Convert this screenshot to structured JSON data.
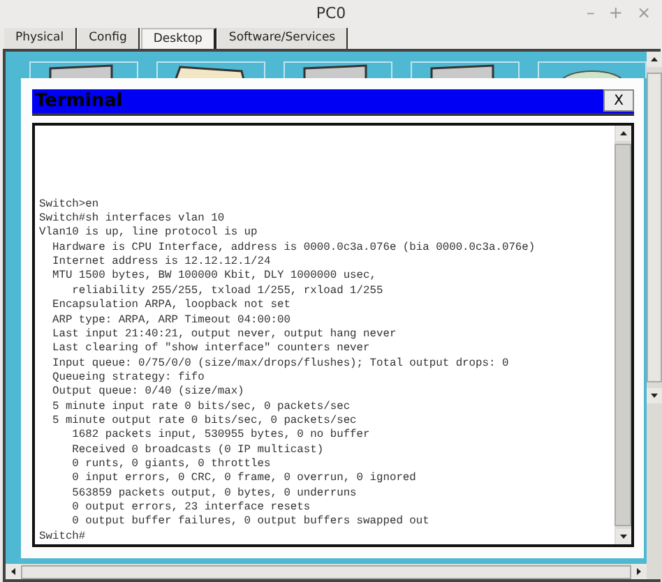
{
  "window": {
    "title": "PC0",
    "controls": [
      "–",
      "+",
      "×"
    ]
  },
  "tabs": [
    {
      "label": "Physical",
      "selected": false
    },
    {
      "label": "Config",
      "selected": false
    },
    {
      "label": "Desktop",
      "selected": true
    },
    {
      "label": "Software/Services",
      "selected": false
    }
  ],
  "terminal": {
    "title": "Terminal",
    "close": "X",
    "lines": [
      "Switch>en",
      "Switch#sh interfaces vlan 10",
      "Vlan10 is up, line protocol is up",
      "  Hardware is CPU Interface, address is 0000.0c3a.076e (bia 0000.0c3a.076e)",
      "  Internet address is 12.12.12.1/24",
      "  MTU 1500 bytes, BW 100000 Kbit, DLY 1000000 usec,",
      "     reliability 255/255, txload 1/255, rxload 1/255",
      "  Encapsulation ARPA, loopback not set",
      "  ARP type: ARPA, ARP Timeout 04:00:00",
      "  Last input 21:40:21, output never, output hang never",
      "  Last clearing of \"show interface\" counters never",
      "  Input queue: 0/75/0/0 (size/max/drops/flushes); Total output drops: 0",
      "  Queueing strategy: fifo",
      "  Output queue: 0/40 (size/max)",
      "  5 minute input rate 0 bits/sec, 0 packets/sec",
      "  5 minute output rate 0 bits/sec, 0 packets/sec",
      "     1682 packets input, 530955 bytes, 0 no buffer",
      "     Received 0 broadcasts (0 IP multicast)",
      "     0 runts, 0 giants, 0 throttles",
      "     0 input errors, 0 CRC, 0 frame, 0 overrun, 0 ignored",
      "     563859 packets output, 0 bytes, 0 underruns",
      "     0 output errors, 23 interface resets",
      "     0 output buffer failures, 0 output buffers swapped out",
      "Switch#"
    ]
  }
}
